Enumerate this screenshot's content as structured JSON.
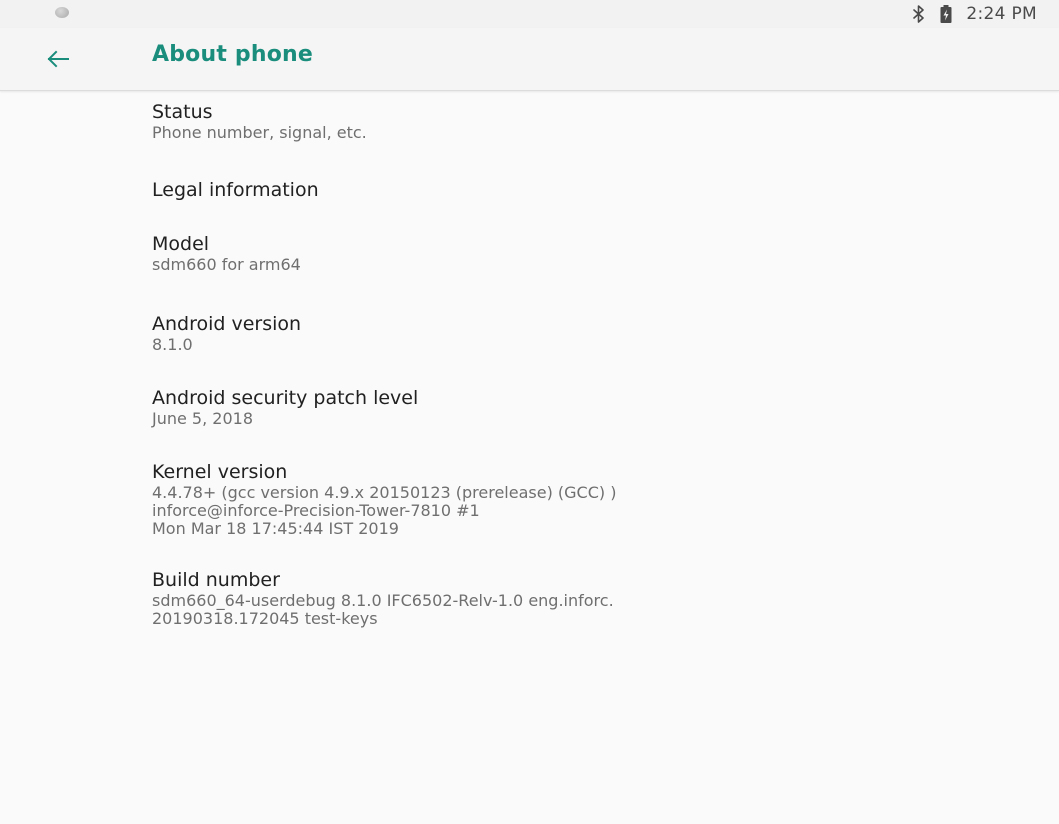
{
  "status_bar": {
    "time": "2:24 PM",
    "icons": [
      "notification-dot-icon",
      "bluetooth-icon",
      "battery-charging-icon"
    ]
  },
  "app_bar": {
    "back_icon": "arrow-left-icon",
    "title": "About phone",
    "accent_color": "#1a8d7d"
  },
  "preferences": [
    {
      "title": "Status",
      "summary": "Phone number, signal, etc."
    },
    {
      "title": "Legal information",
      "summary": ""
    },
    {
      "title": "Model",
      "summary": "sdm660 for arm64"
    },
    {
      "title": "Android version",
      "summary": "8.1.0"
    },
    {
      "title": "Android security patch level",
      "summary": "June 5, 2018"
    },
    {
      "title": "Kernel version",
      "summary": "4.4.78+ (gcc version 4.9.x 20150123 (prerelease) (GCC) )\ninforce@inforce-Precision-Tower-7810 #1\nMon Mar 18 17:45:44 IST 2019"
    },
    {
      "title": "Build number",
      "summary": "sdm660_64-userdebug 8.1.0 IFC6502-Relv-1.0 eng.inforc.\n20190318.172045 test-keys"
    }
  ]
}
